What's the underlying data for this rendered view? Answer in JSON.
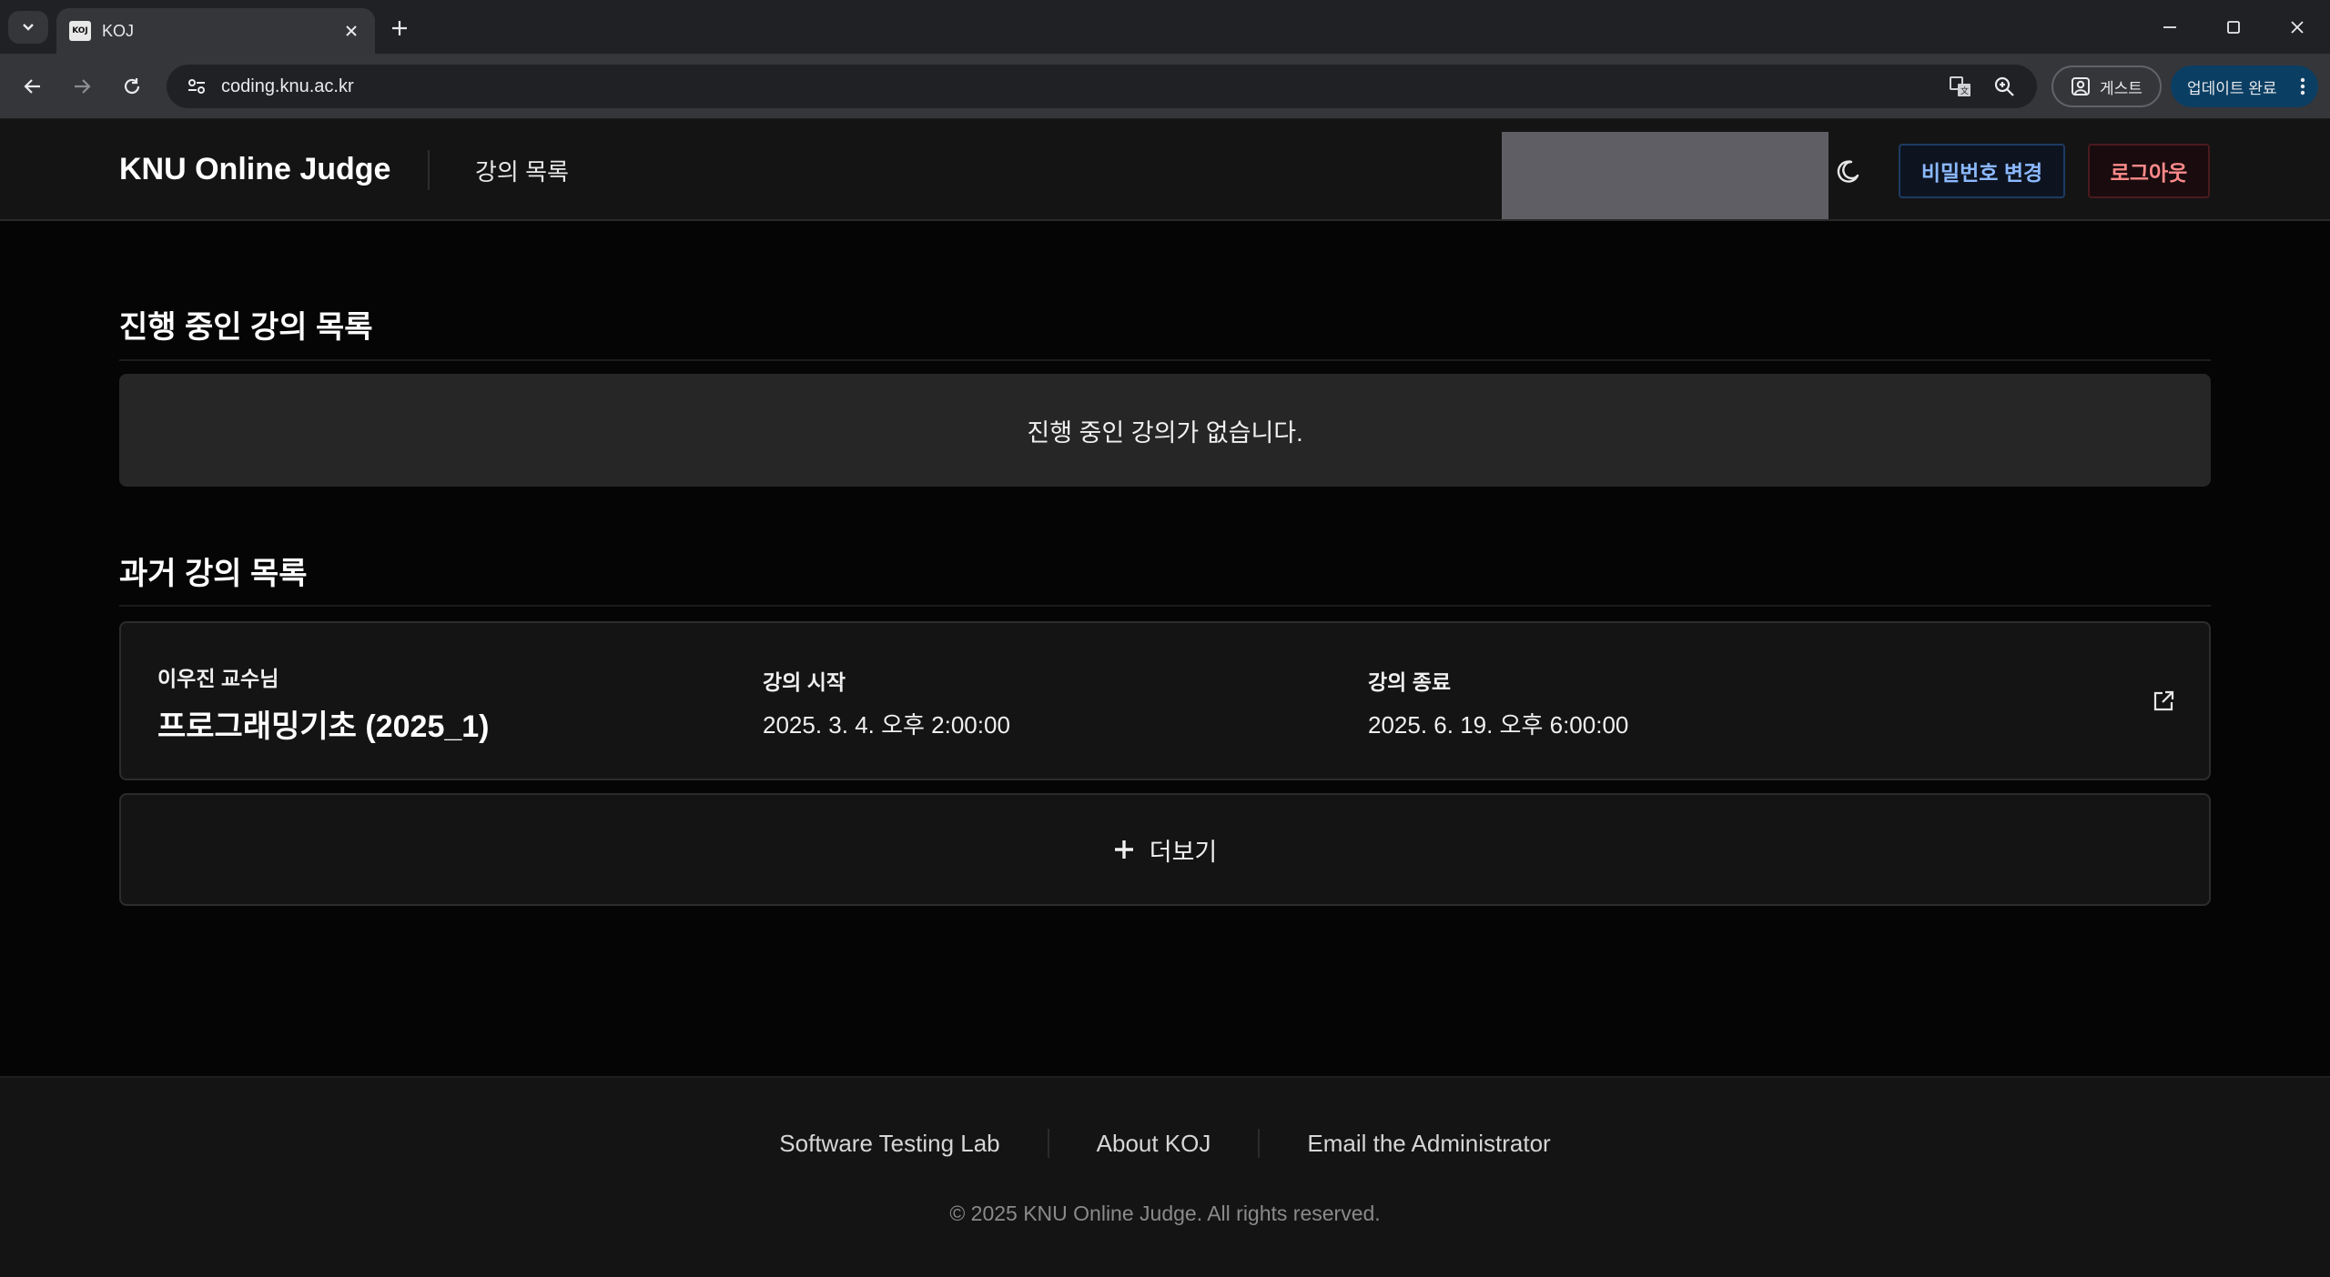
{
  "browser": {
    "tab_title": "KOJ",
    "favicon_text": "KOJ",
    "url": "coding.knu.ac.kr",
    "guest_label": "게스트",
    "update_label": "업데이트 완료"
  },
  "header": {
    "brand": "KNU Online Judge",
    "nav_link": "강의 목록",
    "change_password": "비밀번호 변경",
    "logout": "로그아웃"
  },
  "ongoing": {
    "title": "진행 중인 강의 목록",
    "empty_message": "진행 중인 강의가 없습니다."
  },
  "past": {
    "title": "과거 강의 목록",
    "courses": [
      {
        "professor": "이우진 교수님",
        "name": "프로그래밍기초 (2025_1)",
        "start_label": "강의 시작",
        "start": "2025. 3. 4. 오후 2:00:00",
        "end_label": "강의 종료",
        "end": "2025. 6. 19. 오후 6:00:00"
      }
    ],
    "more_label": "더보기"
  },
  "footer": {
    "links": [
      "Software Testing Lab",
      "About KOJ",
      "Email the Administrator"
    ],
    "copyright": "© 2025 KNU Online Judge. All rights reserved."
  }
}
